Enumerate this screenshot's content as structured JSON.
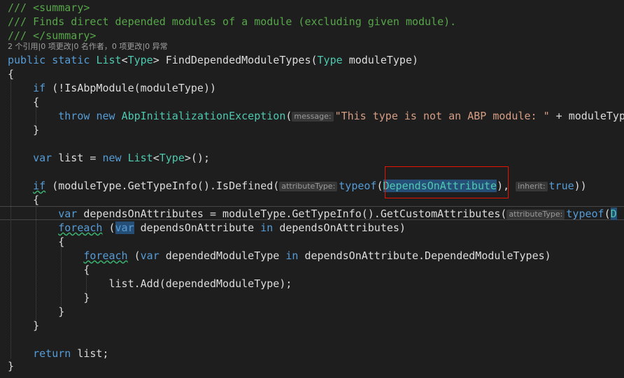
{
  "doc_comment": {
    "open": "/// <summary>",
    "text": "/// Finds direct depended modules of a module (excluding given module).",
    "close": "/// </summary>"
  },
  "codelens": {
    "references": "2 个引用",
    "changes": "0 项更改",
    "authors": "0 名作者，0 项更改",
    "exceptions": "0 异常",
    "sep": "|"
  },
  "method": {
    "kw1": "public",
    "kw2": "static",
    "ret_type": "List",
    "ret_type_arg": "Type",
    "name": "FindDependedModuleTypes",
    "param_type": "Type",
    "param_name": "moduleType"
  },
  "code": {
    "open_brace": "{",
    "close_brace": "}",
    "if_kw": "if",
    "if1_cond": "(!IsAbpModule(moduleType))",
    "throw_kw": "throw",
    "new_kw": "new",
    "exception_type": "AbpInitializationException",
    "hint_message": "message:",
    "message_str": "\"This type is not an ABP module: \"",
    "message_rest": " + moduleType",
    "var_kw": "var",
    "list_decl": "list = ",
    "list_type": "List",
    "type_arg": "Type",
    "list_end": "();",
    "if2_cond_pre": "(moduleType.GetTypeInfo().IsDefined(",
    "hint_attributeType": "attributeType:",
    "typeof_kw": "typeof",
    "depends_attr": "DependsOnAttribute",
    "comma": ", ",
    "hint_inherit": "inherit:",
    "true_kw": "true",
    "close2": "))",
    "depends_decl": "dependsOnAttributes = moduleType.GetTypeInfo().GetCustomAttributes(",
    "depends_trunc": "D",
    "foreach_kw": "foreach",
    "foreach1_var": "dependsOnAttribute",
    "in_kw": "in",
    "foreach1_coll": "dependsOnAttributes)",
    "foreach2_rest": "dependedModuleType",
    "foreach2_coll": "dependsOnAttribute.DependedModuleTypes)",
    "list_add": "list.Add(dependedModuleType);",
    "return_kw": "return",
    "return_rest": " list;"
  },
  "colors": {
    "background": "#1e1e1e",
    "keyword": "#569cd6",
    "type": "#4ec9b0",
    "comment": "#57a64a",
    "string": "#d69d85",
    "highlight_box": "#e51400"
  }
}
